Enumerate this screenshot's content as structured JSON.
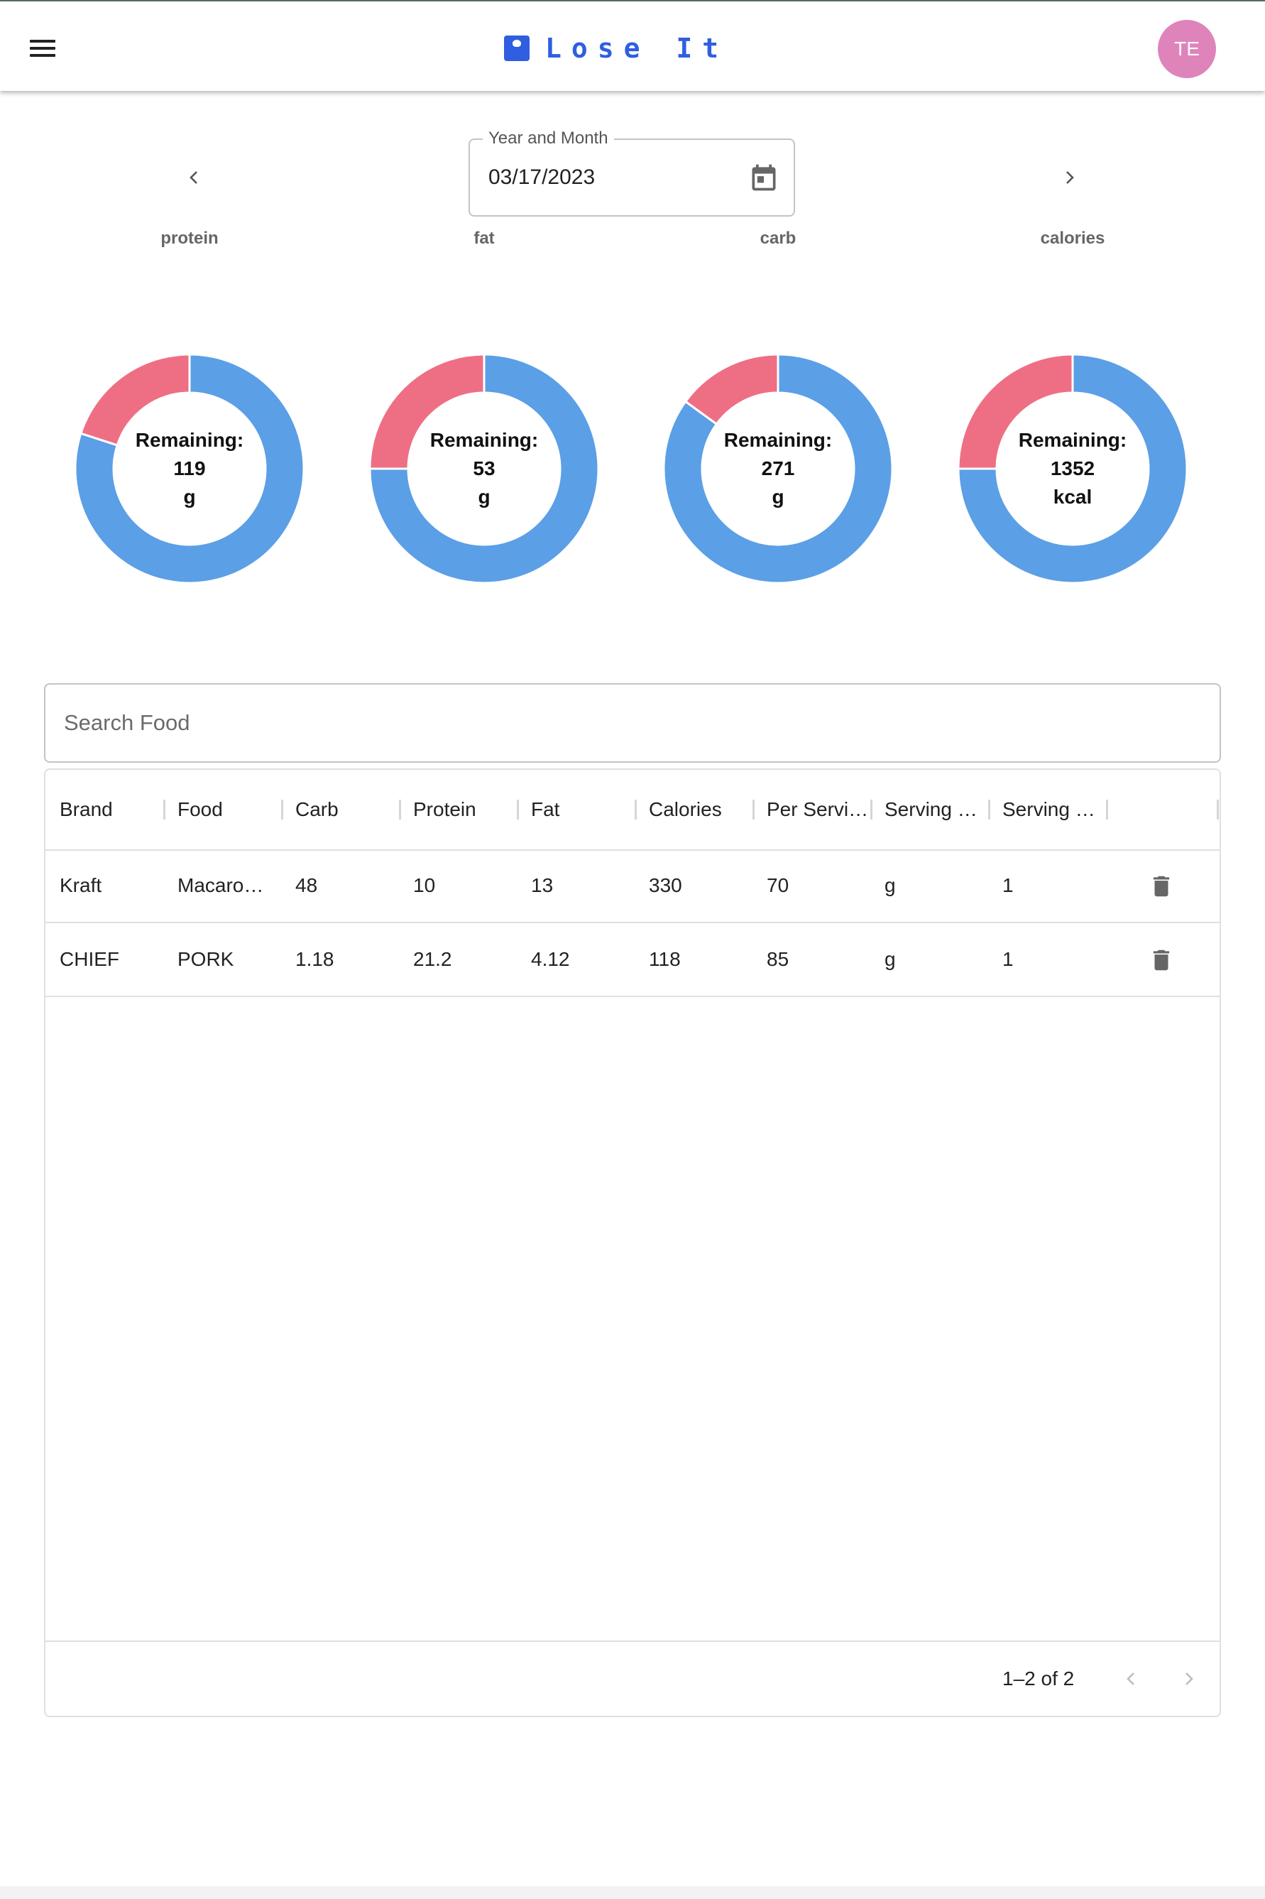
{
  "app": {
    "title": "Lose It",
    "avatar_initials": "TE",
    "brand_color": "#2f5fe0",
    "avatar_color": "#de84bb"
  },
  "date_picker": {
    "label": "Year and Month",
    "value": "03/17/2023"
  },
  "macros": {
    "colors": {
      "consumed": "#ee6f84",
      "remaining": "#5b9fe6"
    },
    "items": [
      {
        "label": "protein",
        "remaining_label": "Remaining:",
        "value": "119",
        "unit": "g",
        "remaining_fraction": 0.8
      },
      {
        "label": "fat",
        "remaining_label": "Remaining:",
        "value": "53",
        "unit": "g",
        "remaining_fraction": 0.75
      },
      {
        "label": "carb",
        "remaining_label": "Remaining:",
        "value": "271",
        "unit": "g",
        "remaining_fraction": 0.85
      },
      {
        "label": "calories",
        "remaining_label": "Remaining:",
        "value": "1352",
        "unit": "kcal",
        "remaining_fraction": 0.75
      }
    ]
  },
  "search": {
    "placeholder": "Search Food"
  },
  "table": {
    "columns": [
      "Brand",
      "Food",
      "Carb",
      "Protein",
      "Fat",
      "Calories",
      "Per Servi…",
      "Serving …",
      "Serving …"
    ],
    "rows": [
      [
        "Kraft",
        "Macaro…",
        "48",
        "10",
        "13",
        "330",
        "70",
        "g",
        "1"
      ],
      [
        "CHIEF",
        "PORK",
        "1.18",
        "21.2",
        "4.12",
        "118",
        "85",
        "g",
        "1"
      ]
    ],
    "pagination": "1–2 of 2"
  }
}
